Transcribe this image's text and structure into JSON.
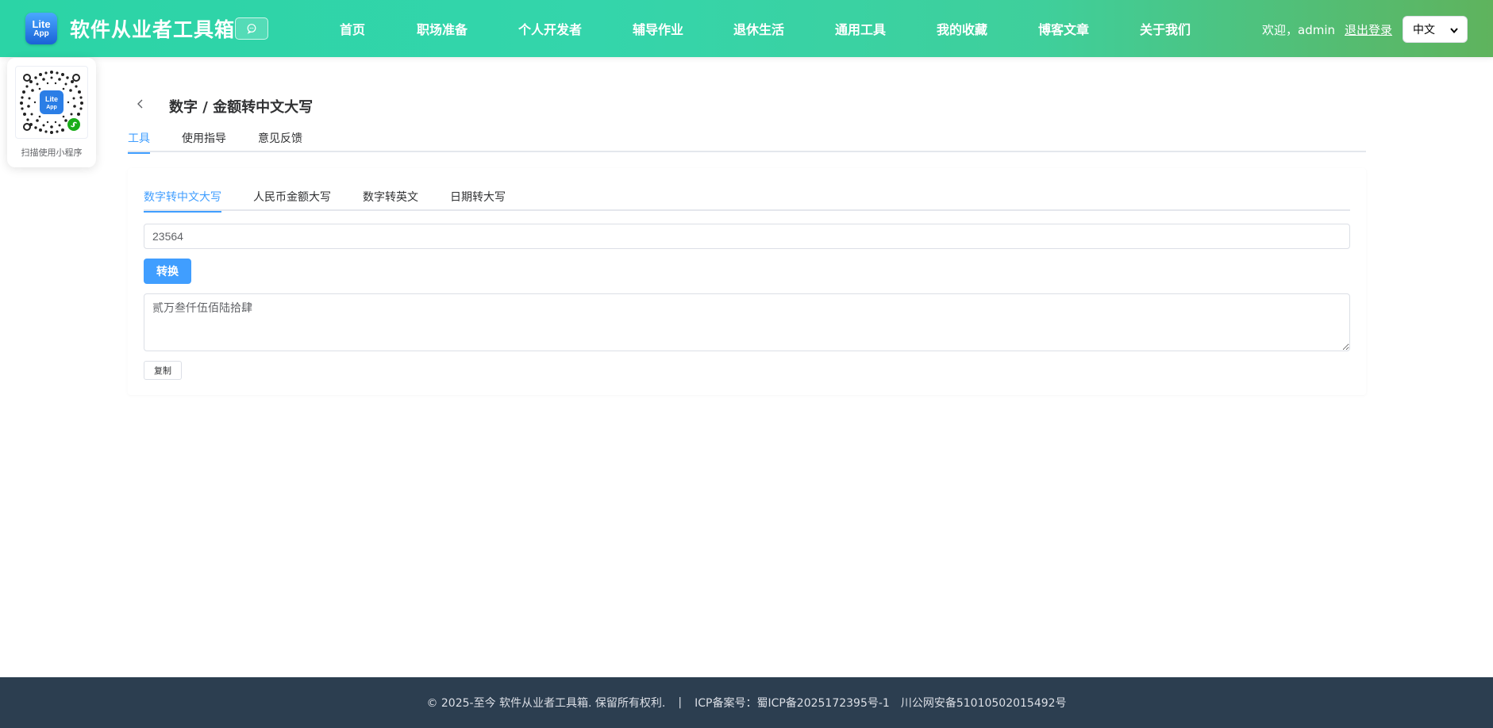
{
  "header": {
    "logo_line1": "Lite",
    "logo_line2": "App",
    "site_title": "软件从业者工具箱",
    "nav": [
      {
        "label": "首页"
      },
      {
        "label": "职场准备"
      },
      {
        "label": "个人开发者"
      },
      {
        "label": "辅导作业"
      },
      {
        "label": "退休生活"
      },
      {
        "label": "通用工具"
      },
      {
        "label": "我的收藏"
      },
      {
        "label": "博客文章"
      },
      {
        "label": "关于我们"
      }
    ],
    "welcome": "欢迎，admin",
    "logout": "退出登录",
    "language": "中文"
  },
  "mini_program": {
    "caption": "扫描使用小程序",
    "qr_logo_line1": "Lite",
    "qr_logo_line2": "App"
  },
  "tool": {
    "title": "数字 / 金额转中文大写",
    "tabs": [
      {
        "label": "工具"
      },
      {
        "label": "使用指导"
      },
      {
        "label": "意见反馈"
      }
    ],
    "sub_tabs": [
      {
        "label": "数字转中文大写"
      },
      {
        "label": "人民币金额大写"
      },
      {
        "label": "数字转英文"
      },
      {
        "label": "日期转大写"
      }
    ],
    "input_value": "23564",
    "convert_label": "转换",
    "result_value": "贰万叁仟伍佰陆拾肆",
    "copy_label": "复制"
  },
  "footer": {
    "copyright": "© 2025-至今 软件从业者工具箱. 保留所有权利.",
    "separator": "|",
    "icp": "ICP备案号：蜀ICP备2025172395号-1",
    "police": "川公网安备51010502015492号"
  },
  "colors": {
    "header_gradient_start": "#2bd4a6",
    "header_gradient_end": "#5fb35d",
    "accent": "#409eff",
    "footer_bg": "#2c3e50"
  }
}
